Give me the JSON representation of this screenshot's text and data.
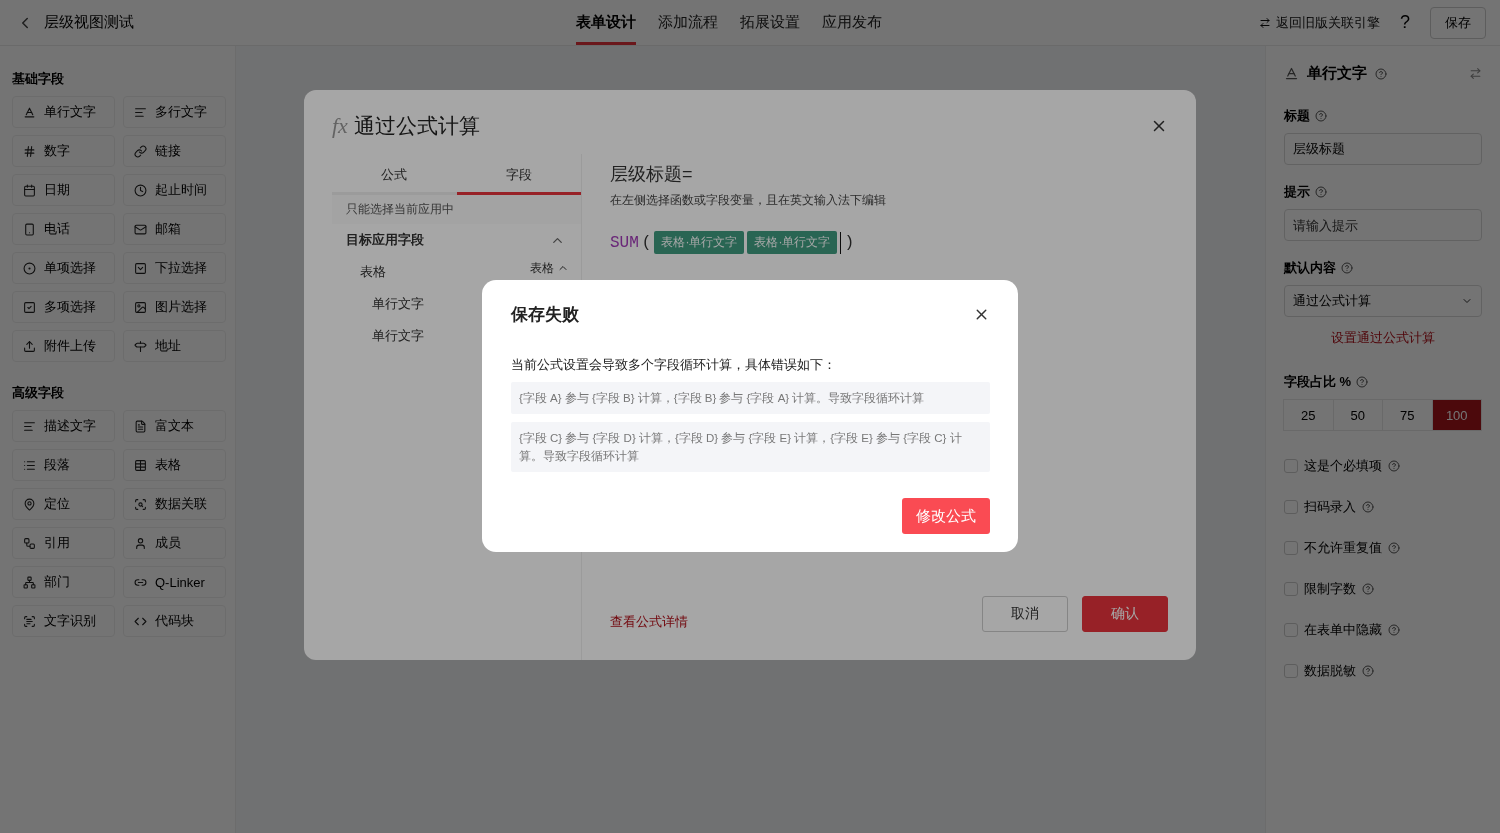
{
  "header": {
    "title": "层级视图测试",
    "tabs": [
      {
        "label": "表单设计",
        "selected": true
      },
      {
        "label": "添加流程",
        "selected": false
      },
      {
        "label": "拓展设置",
        "selected": false
      },
      {
        "label": "应用发布",
        "selected": false
      }
    ],
    "legacy_link": "返回旧版关联引擎",
    "help": "?",
    "save": "保存"
  },
  "sidebar": {
    "sections": [
      {
        "title": "基础字段",
        "items": [
          "单行文字",
          "多行文字",
          "数字",
          "链接",
          "日期",
          "起止时间",
          "电话",
          "邮箱",
          "单项选择",
          "下拉选择",
          "多项选择",
          "图片选择",
          "附件上传",
          "地址"
        ]
      },
      {
        "title": "高级字段",
        "items": [
          "描述文字",
          "富文本",
          "段落",
          "表格",
          "定位",
          "数据关联",
          "引用",
          "成员",
          "部门",
          "Q-Linker",
          "文字识别",
          "代码块"
        ]
      }
    ]
  },
  "properties": {
    "field_type": "单行文字",
    "title": {
      "label": "标题",
      "value": "层级标题"
    },
    "hint": {
      "label": "提示",
      "placeholder": "请输入提示"
    },
    "default": {
      "label": "默认内容",
      "value": "通过公式计算",
      "link": "设置通过公式计算"
    },
    "width": {
      "label": "字段占比 %",
      "options": [
        {
          "label": "25",
          "selected": false
        },
        {
          "label": "50",
          "selected": false
        },
        {
          "label": "75",
          "selected": false
        },
        {
          "label": "100",
          "selected": true
        }
      ]
    },
    "options": [
      {
        "label": "这是个必填项",
        "checked": false
      },
      {
        "label": "扫码录入",
        "checked": false
      },
      {
        "label": "不允许重复值",
        "checked": false
      },
      {
        "label": "限制字数",
        "checked": false
      },
      {
        "label": "在表单中隐藏",
        "checked": false
      },
      {
        "label": "数据脱敏",
        "checked": false
      }
    ]
  },
  "formula_dialog": {
    "icon": "fx",
    "title": "通过公式计算",
    "tabs": [
      {
        "label": "公式",
        "selected": false
      },
      {
        "label": "字段",
        "selected": true
      }
    ],
    "note": "只能选择当前应用中",
    "tree": [
      {
        "label": "目标应用字段",
        "expanded": true,
        "children": [
          {
            "label": "表格",
            "tag": "表格",
            "expanded": true,
            "children": [
              {
                "label": "单行文字"
              },
              {
                "label": "单行文字"
              }
            ]
          }
        ]
      }
    ],
    "target": "层级标题=",
    "instructions": "在左侧选择函数或字段变量，且在英文输入法下编辑",
    "formula": {
      "function": "SUM",
      "open": "(",
      "tokens": [
        "表格·单行文字",
        "表格·单行文字"
      ],
      "close": ")"
    },
    "detail_link": "查看公式详情",
    "buttons": [
      {
        "label": "取消",
        "kind": "default"
      },
      {
        "label": "确认",
        "kind": "primary"
      }
    ]
  },
  "error_dialog": {
    "title": "保存失败",
    "message": "当前公式设置会导致多个字段循环计算，具体错误如下：",
    "errors": [
      "{字段 A} 参与 {字段 B} 计算，{字段 B} 参与 {字段 A} 计算。导致字段循环计算",
      "{字段 C} 参与 {字段 D} 计算，{字段 D} 参与 {字段 E} 计算，{字段 E} 参与 {字段 C} 计算。导致字段循环计算"
    ],
    "button": "修改公式"
  }
}
